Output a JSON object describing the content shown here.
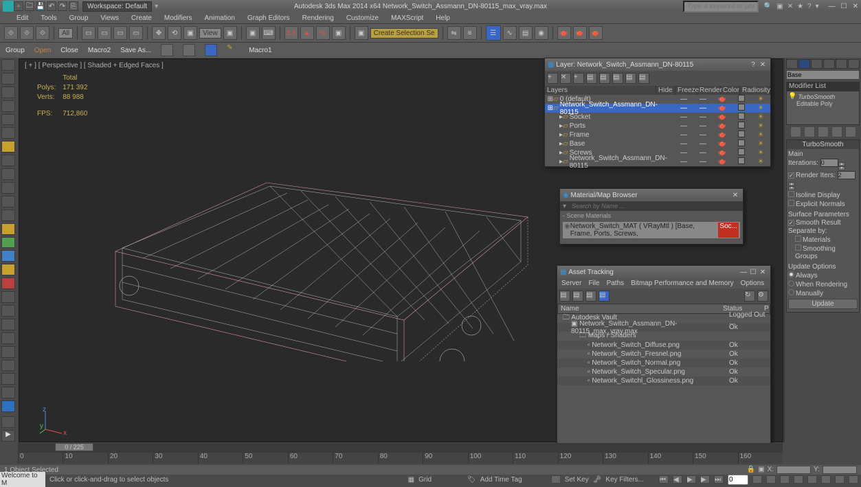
{
  "title": "Autodesk 3ds Max  2014 x64    Network_Switch_Assmann_DN-80115_max_vray.max",
  "workspace": "Workspace: Default",
  "search_placeholder": "Type a keyword or phrase",
  "menus": [
    "Edit",
    "Tools",
    "Group",
    "Views",
    "Create",
    "Modifiers",
    "Animation",
    "Graph Editors",
    "Rendering",
    "Customize",
    "MAXScript",
    "Help"
  ],
  "secondbar": {
    "items": [
      "Group",
      "Open",
      "Close",
      "Macro2",
      "Save As...",
      "Macro1"
    ]
  },
  "toolbar": {
    "sel_all": "All",
    "sel_view": "View",
    "y_label": "Create Selection Se"
  },
  "viewport": {
    "label": "[ + ] [ Perspective ] [ Shaded + Edged Faces ]",
    "stats": {
      "head": "Total",
      "polys_l": "Polys:",
      "polys_v": "171 392",
      "verts_l": "Verts:",
      "verts_v": "88 988",
      "fps_l": "FPS:",
      "fps_v": "712,860"
    }
  },
  "layer_panel": {
    "title": "Layer: Network_Switch_Assmann_DN-80115",
    "cols": [
      "Layers",
      "Hide",
      "Freeze",
      "Render",
      "Color",
      "Radiosity"
    ],
    "rows": [
      {
        "name": "0 (default)",
        "indent": 0,
        "sel": false
      },
      {
        "name": "Network_Switch_Assmann_DN-80115",
        "indent": 0,
        "sel": true
      },
      {
        "name": "Socket",
        "indent": 1,
        "sel": false
      },
      {
        "name": "Ports",
        "indent": 1,
        "sel": false
      },
      {
        "name": "Frame",
        "indent": 1,
        "sel": false
      },
      {
        "name": "Base",
        "indent": 1,
        "sel": false
      },
      {
        "name": "Screws",
        "indent": 1,
        "sel": false
      },
      {
        "name": "Network_Switch_Assmann_DN-80115",
        "indent": 1,
        "sel": false
      }
    ]
  },
  "mat_panel": {
    "title": "Material/Map Browser",
    "search": "Search by Name ...",
    "section": "- Scene Materials",
    "item": "Network_Switch_MAT ( VRayMtl )   [Base, Frame, Ports, Screws, ",
    "item_overflow": "Soc..."
  },
  "asset_panel": {
    "title": "Asset Tracking",
    "menu": [
      "Server",
      "File",
      "Paths",
      "Bitmap Performance and Memory",
      "Options"
    ],
    "cols": {
      "name": "Name",
      "status": "Status",
      "p": "P"
    },
    "rows": [
      {
        "n": "Autodesk Vault",
        "s": "Logged Out ...",
        "i": 0,
        "ic": "🗀"
      },
      {
        "n": "Network_Switch_Assmann_DN-80115_max_vray.max",
        "s": "Ok",
        "i": 1,
        "ic": "▣"
      },
      {
        "n": "Maps / Shaders",
        "s": "",
        "i": 2,
        "ic": "🗀"
      },
      {
        "n": "Network_Switch_Diffuse.png",
        "s": "Ok",
        "i": 3,
        "ic": "▫"
      },
      {
        "n": "Network_Switch_Fresnel.png",
        "s": "Ok",
        "i": 3,
        "ic": "▫"
      },
      {
        "n": "Network_Switch_Normal.png",
        "s": "Ok",
        "i": 3,
        "ic": "▫"
      },
      {
        "n": "Network_Switch_Specular.png",
        "s": "Ok",
        "i": 3,
        "ic": "▫"
      },
      {
        "n": "Network_Switchl_Glossiness.png",
        "s": "Ok",
        "i": 3,
        "ic": "▫"
      }
    ]
  },
  "modifier_panel": {
    "obj": "Base",
    "list_label": "Modifier List",
    "stack": [
      "TurboSmooth",
      "Editable Poly"
    ],
    "turbo_head": "TurboSmooth",
    "main_label": "Main",
    "iterations": "Iterations:",
    "iterations_v": "0",
    "render_iters": "Render Iters:",
    "render_iters_v": "2",
    "isoline": "Isoline Display",
    "explicit": "Explicit Normals",
    "surf_head": "Surface Parameters",
    "smooth_result": "Smooth Result",
    "separate": "Separate by:",
    "materials": "Materials",
    "smoothing": "Smoothing Groups",
    "update_head": "Update Options",
    "always": "Always",
    "when_render": "When Rendering",
    "manually": "Manually",
    "update_btn": "Update"
  },
  "timeline": {
    "thumb": "0 / 225",
    "ticks": [
      "0",
      "10",
      "20",
      "30",
      "40",
      "50",
      "60",
      "70",
      "80",
      "90",
      "100",
      "110",
      "120",
      "130",
      "140",
      "150",
      "160"
    ]
  },
  "status": {
    "sel": "1 Object Selected",
    "welcome": "Welcome to M",
    "hint": "Click or click-and-drag to select objects",
    "grid": "Grid",
    "addtime": "Add Time Tag",
    "setkey": "Set Key",
    "keyfilters": "Key Filters..."
  }
}
